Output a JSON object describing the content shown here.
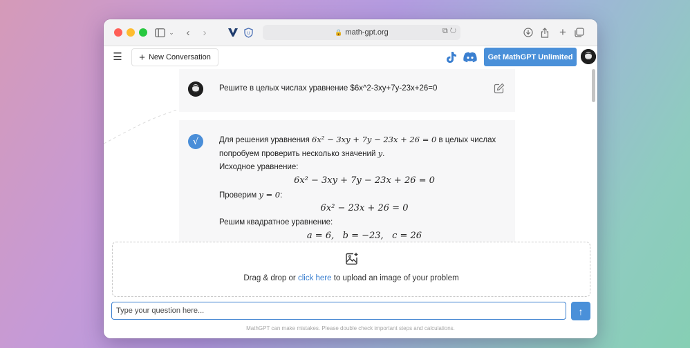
{
  "browser": {
    "url": "math-gpt.org"
  },
  "header": {
    "new_conversation_label": "New Conversation",
    "cta_label": "Get MathGPT Unlimited"
  },
  "conversation": {
    "user_message": "Решите в целых числах уравнение $6x^2-3xy+7y-23x+26=0",
    "bot_lines": {
      "l1_pre": "Для решения уравнения ",
      "l1_math": "6x² − 3xy + 7y − 23x + 26 = 0",
      "l1_post": " в целых числах",
      "l2_pre": "попробуем проверить несколько значений ",
      "l2_math": "y",
      "l2_post": ".",
      "l3": "Исходное уравнение:",
      "l4_math": "6x² − 3xy + 7y − 23x + 26 = 0",
      "l5_pre": "Проверим ",
      "l5_math": "y = 0",
      "l5_post": ":",
      "l6_math": "6x² − 23x + 26 = 0",
      "l7": "Решим квадратное уравнение:",
      "l8_math": "a = 6,   b = −23,   c = 26"
    }
  },
  "upload": {
    "text_pre": "Drag & drop or ",
    "link": "click here",
    "text_post": " to upload an image of your problem"
  },
  "input": {
    "placeholder": "Type your question here..."
  },
  "footer": {
    "disclaimer": "MathGPT can make mistakes. Please double check important steps and calculations."
  },
  "colors": {
    "accent": "#4a90d9",
    "link": "#3a7fd0"
  }
}
